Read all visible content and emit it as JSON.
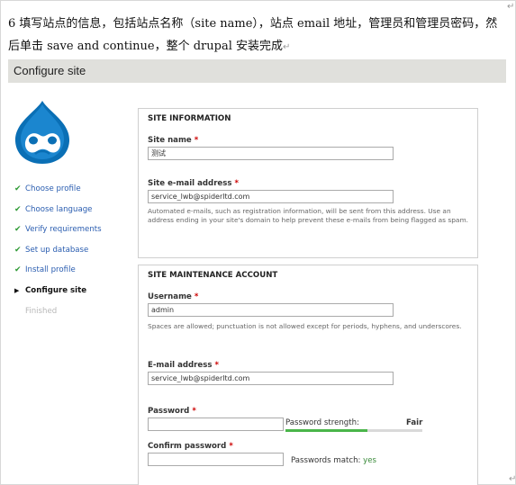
{
  "intro": {
    "text": "6  填写站点的信息，包括站点名称（site name），站点 email 地址，管理员和管理员密码，然后单击 save and continue，整个 drupal 安装完成",
    "para_mark": "↵"
  },
  "header": {
    "title": "Configure site"
  },
  "steps": [
    {
      "label": "Choose profile",
      "status": "done",
      "icon": "check-icon"
    },
    {
      "label": "Choose language",
      "status": "done",
      "icon": "check-icon"
    },
    {
      "label": "Verify requirements",
      "status": "done",
      "icon": "check-icon"
    },
    {
      "label": "Set up database",
      "status": "done",
      "icon": "check-icon"
    },
    {
      "label": "Install profile",
      "status": "done",
      "icon": "check-icon"
    },
    {
      "label": "Configure site",
      "status": "active",
      "icon": "triangle-right-icon"
    },
    {
      "label": "Finished",
      "status": "pending",
      "icon": ""
    }
  ],
  "site_info": {
    "legend": "SITE INFORMATION",
    "site_name_label": "Site name",
    "site_name_value": "测试",
    "email_label": "Site e-mail address",
    "email_value": "service_lwb@spiderltd.com",
    "email_desc": "Automated e-mails, such as registration information, will be sent from this address. Use an address ending in your site's domain to help prevent these e-mails from being flagged as spam."
  },
  "maintenance": {
    "legend": "SITE MAINTENANCE ACCOUNT",
    "username_label": "Username",
    "username_value": "admin",
    "username_desc": "Spaces are allowed; punctuation is not allowed except for periods, hyphens, and underscores.",
    "email_label": "E-mail address",
    "email_value": "service_lwb@spiderltd.com",
    "password_label": "Password",
    "password_value": "",
    "strength_label": "Password strength:",
    "strength_value": "Fair",
    "strength_fraction": 0.6,
    "confirm_label": "Confirm password",
    "confirm_value": "",
    "match_label": "Passwords match:",
    "match_value": "yes"
  },
  "required_marker": "*",
  "colors": {
    "header_bg": "#e0e0dc",
    "check_green": "#2e9a35",
    "link_blue": "#2a5db0",
    "required_red": "#cc0000",
    "meter_green": "#4ab54a",
    "logo_blue": "#0073ba"
  }
}
